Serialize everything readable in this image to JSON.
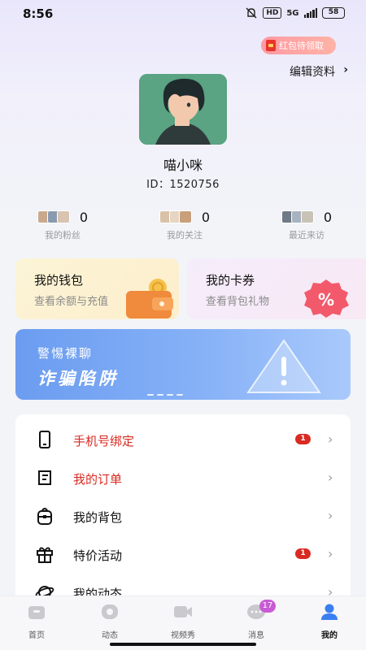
{
  "status_bar": {
    "time": "8:56",
    "hd": "HD",
    "network": "5G",
    "battery": "58"
  },
  "red_packet": {
    "label": "红包待领取"
  },
  "edit_profile": {
    "label": "编辑资料",
    "chevron": "›"
  },
  "profile": {
    "name": "喵小咪",
    "id_prefix": "ID：",
    "id_value": "1520756"
  },
  "stats": [
    {
      "count": "0",
      "label": "我的粉丝"
    },
    {
      "count": "0",
      "label": "我的关注"
    },
    {
      "count": "0",
      "label": "最近来访"
    }
  ],
  "cards": {
    "wallet": {
      "title": "我的钱包",
      "subtitle": "查看余额与充值"
    },
    "coupon": {
      "title": "我的卡券",
      "subtitle": "查看背包礼物"
    }
  },
  "banner": {
    "title": "警惕裸聊",
    "slogan": "诈骗陷阱"
  },
  "menu": {
    "items": [
      {
        "label": "手机号绑定",
        "badge": "1",
        "icon": "phone-icon",
        "highlight": true
      },
      {
        "label": "我的订单",
        "badge": "",
        "icon": "order-icon",
        "highlight": true
      },
      {
        "label": "我的背包",
        "badge": "",
        "icon": "backpack-icon",
        "highlight": false
      },
      {
        "label": "特价活动",
        "badge": "1",
        "icon": "gift-icon",
        "highlight": false
      },
      {
        "label": "我的动态",
        "badge": "",
        "icon": "planet-icon",
        "highlight": false
      }
    ],
    "chevron": "›"
  },
  "bottom_nav": {
    "items": [
      {
        "label": "首页",
        "icon": "home-icon"
      },
      {
        "label": "动态",
        "icon": "moments-icon"
      },
      {
        "label": "视频秀",
        "icon": "video-icon"
      },
      {
        "label": "消息",
        "icon": "message-icon",
        "badge": "17"
      },
      {
        "label": "我的",
        "icon": "profile-icon",
        "active": true
      }
    ]
  },
  "colors": {
    "accent_red": "#d92a22",
    "banner_blue": "#6b9cf0",
    "active_nav": "#3a7ff0",
    "message_badge": "#c85bd5"
  }
}
